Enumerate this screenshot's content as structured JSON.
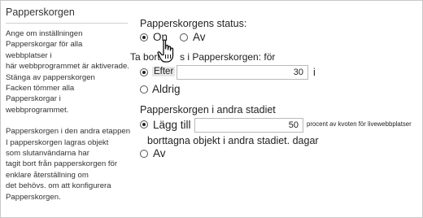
{
  "section": {
    "title": "Papperskorgen",
    "description_lines": [
      "Ange om inställningen",
      "Papperskorgar för alla",
      "webbplatser i",
      "här webbprogrammet är aktiverade.",
      "Stänga av papperskorgen",
      "Facken tömmer alla",
      "Papperskorgar i",
      "webbprogrammet."
    ],
    "description2_lines": [
      "Papperskorgen i den andra etappen",
      "I papperskorgen lagras objekt",
      "som slutanvändarna har",
      "tagit bort från papperskorgen för",
      "enklare återställning om",
      "det behövs. om att konfigurera",
      "Papperskorgen."
    ]
  },
  "status": {
    "label": "Papperskorgens status:",
    "on_label": "On",
    "off_label": "Av",
    "selected": "on"
  },
  "delete": {
    "label_start": "Ta bort",
    "label_end": "s i Papperskorgen: för",
    "after_label": "Efter",
    "after_value": "30",
    "unit": "i",
    "never_label": "Aldrig",
    "selected": "after"
  },
  "second_stage": {
    "label": "Papperskorgen i andra stadiet",
    "add_label": "Lägg till",
    "add_value": "50",
    "quota_text": "procent av kvoten för livewebbplatser",
    "deleted_text": "borttagna objekt i andra stadiet. dagar",
    "off_label": "Av",
    "selected": "add"
  },
  "icons": {
    "cursor": "hand-pointer-icon"
  }
}
